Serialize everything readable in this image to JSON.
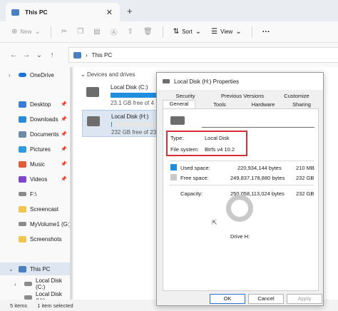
{
  "window": {
    "tab_title": "This PC",
    "tab_close": "✕",
    "new_tab": "+"
  },
  "toolbar": {
    "new_label": "New",
    "sort_label": "Sort",
    "view_label": "View",
    "more_label": "···"
  },
  "address": {
    "path": "This PC",
    "separator": "›"
  },
  "sidebar": {
    "items": [
      {
        "label": "OneDrive",
        "icon": "cloud-icon"
      },
      {
        "label": "Desktop",
        "icon": "desktop-icon",
        "pinned": true
      },
      {
        "label": "Downloads",
        "icon": "downloads-icon",
        "pinned": true
      },
      {
        "label": "Documents",
        "icon": "documents-icon",
        "pinned": true
      },
      {
        "label": "Pictures",
        "icon": "pictures-icon",
        "pinned": true
      },
      {
        "label": "Music",
        "icon": "music-icon",
        "pinned": true
      },
      {
        "label": "Videos",
        "icon": "videos-icon",
        "pinned": true
      },
      {
        "label": "F:\\",
        "icon": "drive-icon"
      },
      {
        "label": "Screencast",
        "icon": "folder-icon"
      },
      {
        "label": "MyVolume1 (G:)",
        "icon": "drive-icon"
      },
      {
        "label": "Screenshots",
        "icon": "folder-icon"
      },
      {
        "label": "This PC",
        "icon": "pc-icon"
      },
      {
        "label": "Local Disk (C:)",
        "icon": "drive-icon"
      },
      {
        "label": "Local Disk (H:)",
        "icon": "drive-icon"
      }
    ]
  },
  "content": {
    "group_label": "Devices and drives",
    "drives": [
      {
        "name": "Local Disk (C:)",
        "free_text": "23.1 GB free of 4",
        "used_fraction": 0.92
      },
      {
        "name": "Local Disk (H:)",
        "free_text": "232 GB free of 23",
        "used_fraction": 0.01
      }
    ]
  },
  "status": {
    "items": "5 items",
    "selected": "1 item selected"
  },
  "dialog": {
    "title": "Local Disk (H:) Properties",
    "tabs_row1": [
      "Security",
      "Previous Versions",
      "Customize"
    ],
    "tabs_row2": [
      "General",
      "Tools",
      "Hardware",
      "Sharing"
    ],
    "type_label": "Type:",
    "type_value": "Local Disk",
    "fs_label": "File system:",
    "fs_value": "Btrfs v4 10.2",
    "used_label": "Used space:",
    "used_bytes": "220,934,144 bytes",
    "used_size": "210 MB",
    "free_label": "Free space:",
    "free_bytes": "249,837,178,880 bytes",
    "free_size": "232 GB",
    "capacity_label": "Capacity:",
    "capacity_bytes": "250,058,113,024 bytes",
    "capacity_size": "232 GB",
    "drive_label": "Drive H:",
    "used_color": "#1f8ee0",
    "free_color": "#c9c9c9",
    "used_fraction": 0.001,
    "ok": "OK",
    "cancel": "Cancel",
    "apply": "Apply"
  }
}
